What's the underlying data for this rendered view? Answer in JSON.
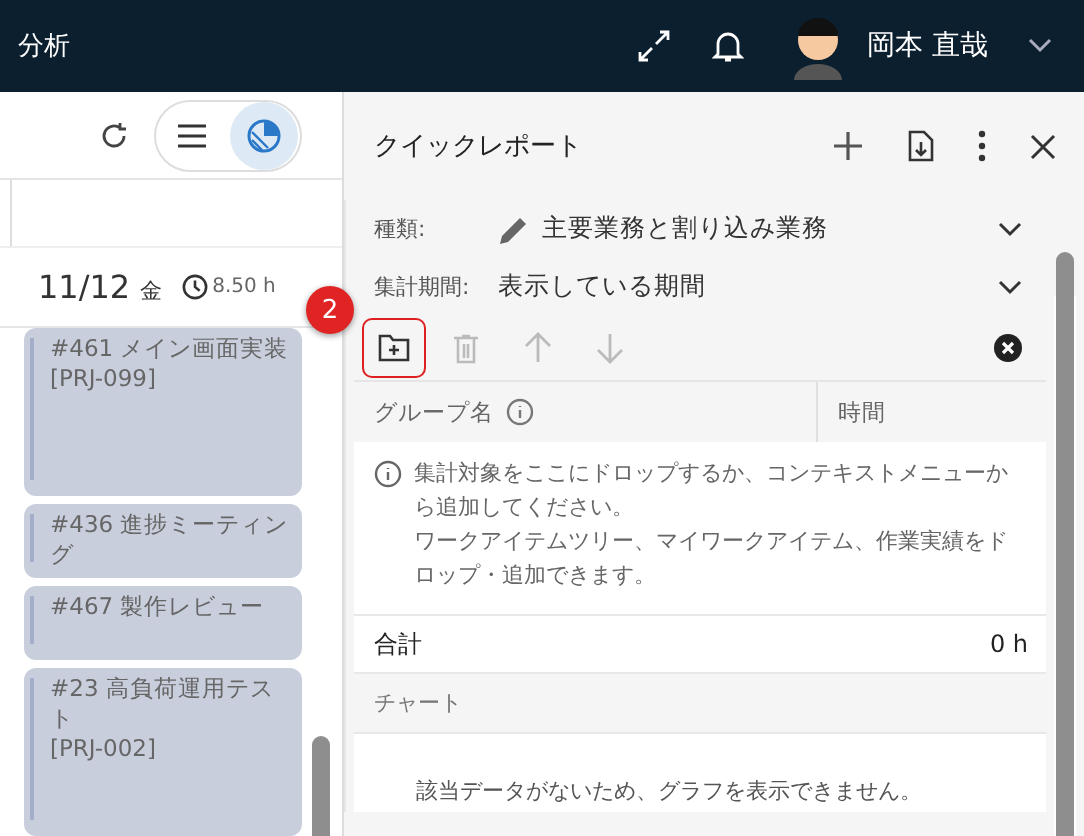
{
  "header": {
    "title": "分析",
    "user_name": "岡本 直哉"
  },
  "calendar": {
    "view_toggle": [
      {
        "kind": "list",
        "selected": false
      },
      {
        "kind": "chart",
        "selected": true
      }
    ],
    "date": "11/12",
    "weekday": "金",
    "hours": "8.50 h",
    "events": [
      {
        "title": "#461 メイン画面実装",
        "project": "[PRJ-099]"
      },
      {
        "title": "#436 進捗ミーティング"
      },
      {
        "title": "#467 製作レビュー"
      },
      {
        "title": "#23 高負荷運用テスト",
        "project": "[PRJ-002]"
      }
    ]
  },
  "quick_report": {
    "title": "クイックレポート",
    "fields": [
      {
        "label": "種類:",
        "value": "主要業務と割り込み業務",
        "kind": "edit"
      },
      {
        "label": "集計期間:",
        "value": "表示している期間",
        "kind": "plain"
      }
    ],
    "toolbar": [
      {
        "kind": "add-group",
        "disabled": false,
        "highlighted": true
      },
      {
        "kind": "delete",
        "disabled": true,
        "highlighted": false
      },
      {
        "kind": "up",
        "disabled": true,
        "highlighted": false
      },
      {
        "kind": "down",
        "disabled": true,
        "highlighted": false
      }
    ],
    "columns": [
      "グループ名",
      "時間"
    ],
    "hint": [
      "集計対象をここにドロップするか、コンテキストメニューから追加してください。",
      "ワークアイテムツリー、マイワークアイテム、作業実績をドロップ・追加できます。"
    ],
    "total_label": "合計",
    "total_value": "0 h",
    "chart_section": "チャート",
    "chart_message": "該当データがないため、グラフを表示できません。"
  },
  "step_badge": "2"
}
